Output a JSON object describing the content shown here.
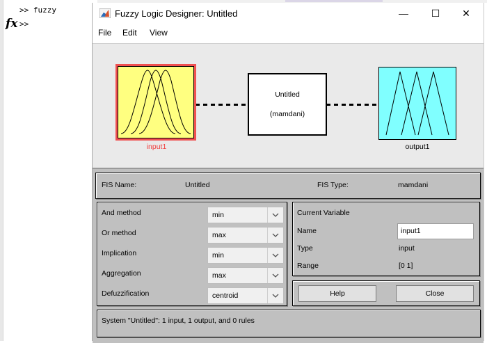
{
  "command_window": {
    "line1": ">> fuzzy",
    "fx_label": "fx",
    "prompt": ">>"
  },
  "window": {
    "title": "Fuzzy Logic Designer: Untitled",
    "app_icon": "matlab-icon",
    "controls": {
      "minimize": "—",
      "maximize": "☐",
      "close": "✕"
    }
  },
  "menu": {
    "file": "File",
    "edit": "Edit",
    "view": "View"
  },
  "diagram": {
    "input_label": "input1",
    "system_name": "Untitled",
    "system_type": "(mamdani)",
    "output_label": "output1",
    "colors": {
      "input_fill": "#ffff80",
      "input_highlight": "#f05050",
      "output_fill": "#80ffff"
    }
  },
  "fis": {
    "name_label": "FIS Name:",
    "name_value": "Untitled",
    "type_label": "FIS Type:",
    "type_value": "mamdani"
  },
  "methods": [
    {
      "label": "And method",
      "value": "min"
    },
    {
      "label": "Or method",
      "value": "max"
    },
    {
      "label": "Implication",
      "value": "min"
    },
    {
      "label": "Aggregation",
      "value": "max"
    },
    {
      "label": "Defuzzification",
      "value": "centroid"
    }
  ],
  "current_variable": {
    "heading": "Current Variable",
    "name_label": "Name",
    "name_value": "input1",
    "type_label": "Type",
    "type_value": "input",
    "range_label": "Range",
    "range_value": "[0 1]"
  },
  "buttons": {
    "help": "Help",
    "close": "Close"
  },
  "status": "System \"Untitled\": 1 input, 1 output, and 0 rules"
}
